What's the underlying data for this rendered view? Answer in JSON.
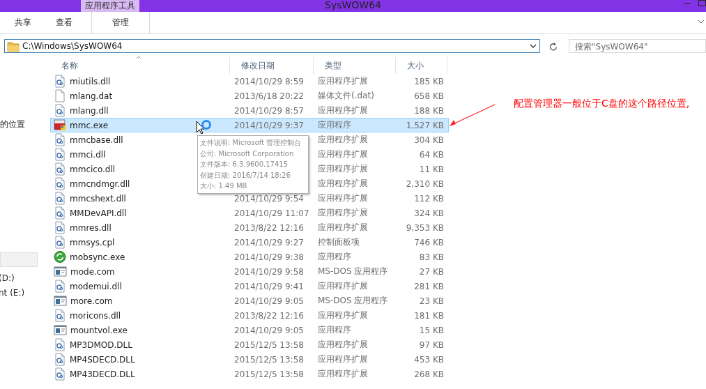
{
  "window": {
    "title": "SysWOW64",
    "context_tab": "应用程序工具"
  },
  "ribbon_tabs": [
    {
      "label": "共享",
      "selected": false
    },
    {
      "label": "查看",
      "selected": false
    },
    {
      "label": "管理",
      "selected": false
    }
  ],
  "address": {
    "value": "C:\\Windows\\SysWOW64"
  },
  "search": {
    "placeholder": "搜索\"SysWOW64\""
  },
  "sidebar": {
    "items": [
      {
        "label": "的位置",
        "selected": false
      },
      {
        "selected": true
      },
      {
        "label": "(D:)",
        "selected": false
      },
      {
        "label": "nt (E:)",
        "selected": false
      }
    ]
  },
  "table": {
    "columns": [
      "名称",
      "修改日期",
      "类型",
      "大小"
    ],
    "rows": [
      {
        "kind": "dll",
        "name": "miutils.dll",
        "date": "2014/10/29 8:59",
        "type": "应用程序扩展",
        "size": "185 KB",
        "selected": false
      },
      {
        "kind": "blank",
        "name": "mlang.dat",
        "date": "2013/6/18 20:22",
        "type": "媒体文件(.dat)",
        "size": "658 KB",
        "selected": false
      },
      {
        "kind": "dll",
        "name": "mlang.dll",
        "date": "2014/10/29 8:57",
        "type": "应用程序扩展",
        "size": "188 KB",
        "selected": false
      },
      {
        "kind": "mmc",
        "name": "mmc.exe",
        "date": "2014/10/29 9:37",
        "type": "应用程序",
        "size": "1,527 KB",
        "selected": true
      },
      {
        "kind": "dll",
        "name": "mmcbase.dll",
        "type": "应用程序扩展",
        "size": "304 KB",
        "selected": false
      },
      {
        "kind": "dll",
        "name": "mmci.dll",
        "type": "应用程序扩展",
        "size": "64 KB",
        "selected": false
      },
      {
        "kind": "dll",
        "name": "mmcico.dll",
        "type": "应用程序扩展",
        "size": "11 KB",
        "selected": false
      },
      {
        "kind": "dll",
        "name": "mmcndmgr.dll",
        "type": "应用程序扩展",
        "size": "2,310 KB",
        "selected": false
      },
      {
        "kind": "dll",
        "name": "mmcshext.dll",
        "date": "2014/10/29 9:54",
        "type": "应用程序扩展",
        "size": "112 KB",
        "selected": false
      },
      {
        "kind": "dll",
        "name": "MMDevAPI.dll",
        "date": "2014/10/29 11:07",
        "type": "应用程序扩展",
        "size": "324 KB",
        "selected": false
      },
      {
        "kind": "dll",
        "name": "mmres.dll",
        "date": "2013/8/22 12:16",
        "type": "应用程序扩展",
        "size": "9,353 KB",
        "selected": false
      },
      {
        "kind": "dll",
        "name": "mmsys.cpl",
        "date": "2014/10/29 9:27",
        "type": "控制面板项",
        "size": "746 KB",
        "selected": false
      },
      {
        "kind": "sync",
        "name": "mobsync.exe",
        "date": "2014/10/29 9:38",
        "type": "应用程序",
        "size": "83 KB",
        "selected": false
      },
      {
        "kind": "console",
        "name": "mode.com",
        "date": "2014/10/29 9:58",
        "type": "MS-DOS 应用程序",
        "size": "27 KB",
        "selected": false
      },
      {
        "kind": "dll",
        "name": "modemui.dll",
        "date": "2014/10/29 9:41",
        "type": "应用程序扩展",
        "size": "281 KB",
        "selected": false
      },
      {
        "kind": "console",
        "name": "more.com",
        "date": "2014/10/29 9:05",
        "type": "MS-DOS 应用程序",
        "size": "23 KB",
        "selected": false
      },
      {
        "kind": "dll",
        "name": "moricons.dll",
        "date": "2013/8/22 12:16",
        "type": "应用程序扩展",
        "size": "181 KB",
        "selected": false
      },
      {
        "kind": "console",
        "name": "mountvol.exe",
        "date": "2014/10/29 9:05",
        "type": "应用程序",
        "size": "15 KB",
        "selected": false
      },
      {
        "kind": "dll",
        "name": "MP3DMOD.DLL",
        "date": "2015/12/5 13:58",
        "type": "应用程序扩展",
        "size": "97 KB",
        "selected": false
      },
      {
        "kind": "dll",
        "name": "MP4SDECD.DLL",
        "date": "2015/12/5 13:58",
        "type": "应用程序扩展",
        "size": "453 KB",
        "selected": false
      },
      {
        "kind": "dll",
        "name": "MP43DECD.DLL",
        "date": "2015/12/5 13:58",
        "type": "应用程序扩展",
        "size": "268 KB",
        "selected": false
      }
    ]
  },
  "tooltip": {
    "lines": [
      "文件说明: Microsoft 管理控制台",
      "公司: Microsoft Corporation",
      "文件版本: 6.3.9600.17415",
      "创建日期: 2016/7/14 18:26",
      "大小: 1.49 MB"
    ]
  },
  "annotation": {
    "text": "配置管理器一般位于C盘的这个路径位置,"
  }
}
